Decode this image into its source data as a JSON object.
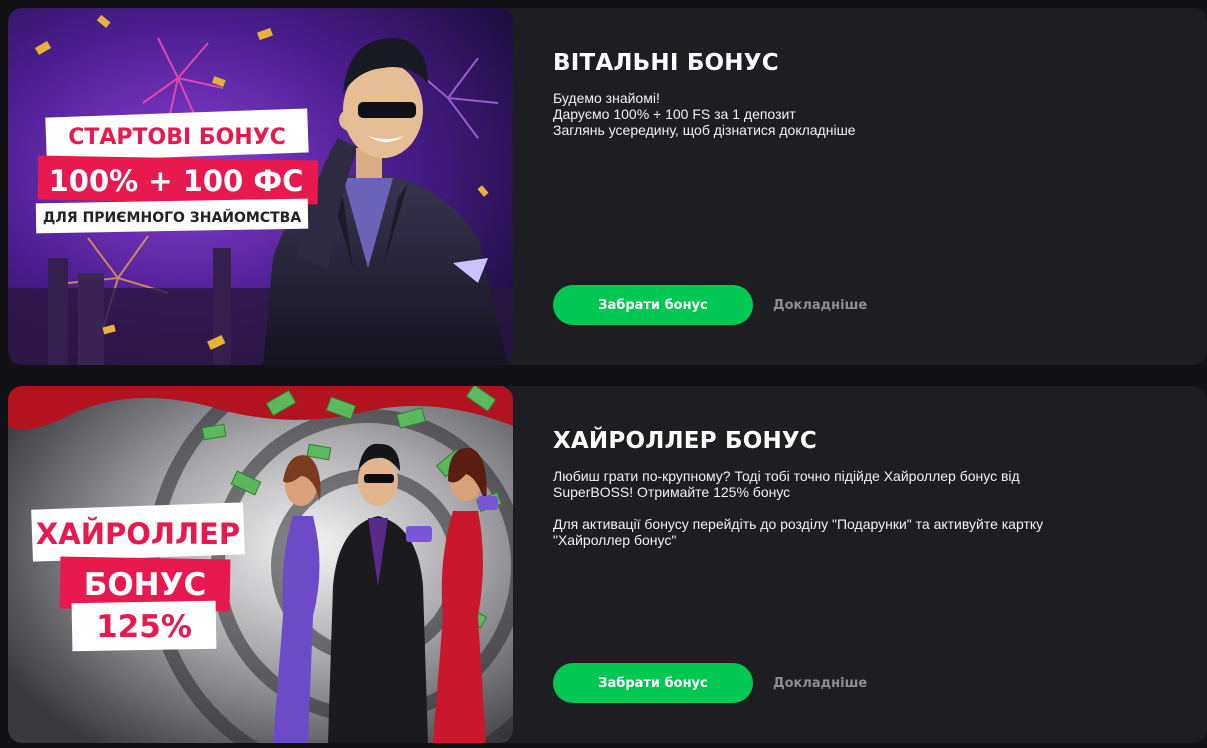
{
  "offers": [
    {
      "title": "ВІТАЛЬНІ БОНУС",
      "desc_lines": [
        "Будемо знайомі!",
        "Даруємо 100% + 100 FS за 1 депозит",
        "Заглянь усередину, щоб дізнатися докладніше"
      ],
      "claim_label": "Забрати бонус",
      "more_label": "Докладніше",
      "banner": {
        "line1": "СТАРТОВІ БОНУС",
        "line2": "100% + 100 ФС",
        "line3": "ДЛЯ ПРИЄМНОГО ЗНАЙОМСТВА"
      }
    },
    {
      "title": "ХАЙРОЛЛЕР БОНУС",
      "desc_lines": [
        "Любиш грати по-крупному? Тоді тобі точно підійде Хайроллер бонус від",
        "SuperBOSS! Отримайте 125% бонус"
      ],
      "desc_lines_2": [
        "Для активації бонусу перейдіть до розділу \"Подарунки\" та активуйте картку",
        "\"Хайроллер бонус\""
      ],
      "claim_label": "Забрати бонус",
      "more_label": "Докладніше",
      "banner": {
        "line1": "ХАЙРОЛЛЕР",
        "line2": "БОНУС",
        "line3": "125%"
      }
    }
  ],
  "colors": {
    "accent": "#00c853",
    "card_bg": "#1e1e22",
    "page_bg": "#121215",
    "brand_pink": "#e8194f"
  }
}
